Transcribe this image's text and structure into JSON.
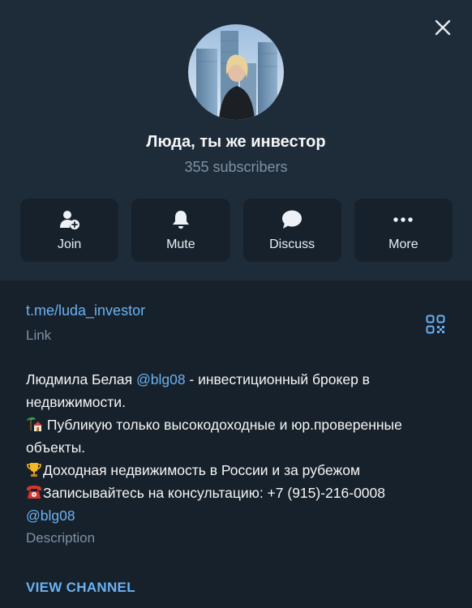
{
  "channel": {
    "name": "Люда, ты же инвестор",
    "subscribers": "355 subscribers"
  },
  "actions": [
    {
      "label": "Join",
      "icon": "add-user-icon"
    },
    {
      "label": "Mute",
      "icon": "bell-icon"
    },
    {
      "label": "Discuss",
      "icon": "chat-bubble-icon"
    },
    {
      "label": "More",
      "icon": "more-dots-icon"
    }
  ],
  "info": {
    "link": "t.me/luda_investor",
    "link_caption": "Link",
    "description": {
      "line1_prefix": "Людмила Белая ",
      "line1_mention": "@blg08",
      "line1_suffix": " - инвестиционный брокер в недвижимости.",
      "line2": " Публикую только высокодоходные и юр.проверенные объекты.",
      "line3": "Доходная недвижимость в России и за рубежом",
      "line4": "Записывайтесь на консультацию: +7 (915)-216-0008",
      "line5_mention": "@blg08"
    },
    "description_caption": "Description"
  },
  "view_channel": "VIEW CHANNEL",
  "colors": {
    "header_bg": "#1e2c3a",
    "body_bg": "#17212b",
    "accent": "#6ab2f2",
    "muted": "#7f91a4"
  }
}
